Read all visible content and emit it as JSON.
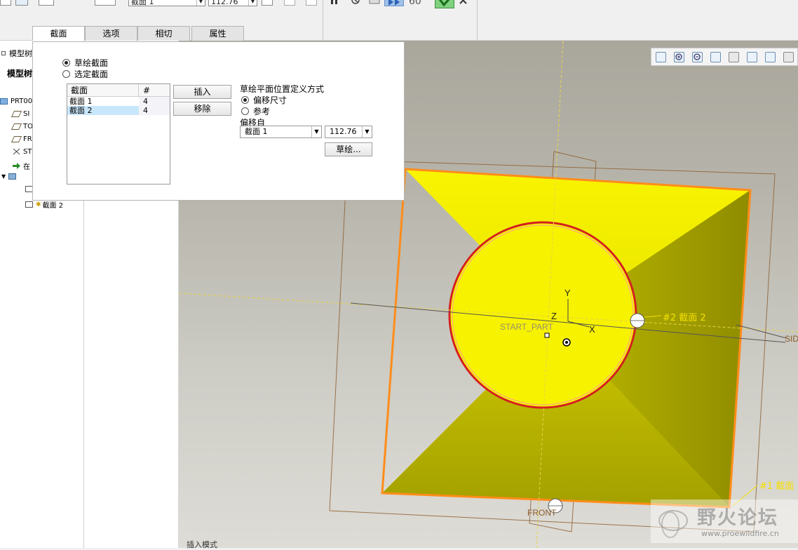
{
  "toolbar": {
    "section_value": "截面 1",
    "offset_value": "112.76",
    "counter": "60"
  },
  "tabs": [
    {
      "label": "截面"
    },
    {
      "label": "选项"
    },
    {
      "label": "相切"
    },
    {
      "label": "属性"
    }
  ],
  "panel": {
    "radio_sketched": "草绘截面",
    "radio_selected": "选定截面",
    "table": {
      "col_section": "截面",
      "col_num": "#",
      "rows": [
        {
          "name": "截面 1",
          "count": "4"
        },
        {
          "name": "截面 2",
          "count": "4"
        }
      ]
    },
    "insert_button": "插入",
    "remove_button": "移除",
    "plane_def_label": "草绘平面位置定义方式",
    "radio_offset_dim": "偏移尺寸",
    "radio_reference": "参考",
    "offset_from_label": "偏移自",
    "offset_from_value": "截面 1",
    "offset_distance_value": "112.76",
    "sketch_button": "草绘..."
  },
  "tree": {
    "title_short": "模型树",
    "header_short": "模型树",
    "items": [
      "PRT00",
      "SI",
      "TO",
      "FR",
      "ST",
      "在",
      "截面 2"
    ]
  },
  "viewport": {
    "label_y": "Y",
    "label_z": "Z",
    "label_x": "X",
    "label_start_part": "START_PART",
    "label_side": "SID",
    "label_front": "FRONT",
    "label_section2": "#2 截面 2",
    "label_section1": "#1 截面"
  },
  "status": "插入模式",
  "watermark": {
    "title": "野火论坛",
    "url": "www.proewildfire.cn"
  },
  "colors": {
    "model_yellow": "#f0ef00",
    "edge_orange": "#ff8c1a",
    "circle_red": "#d42020",
    "label_yellow": "#f4e000",
    "accept_green": "#2a9a2a"
  }
}
